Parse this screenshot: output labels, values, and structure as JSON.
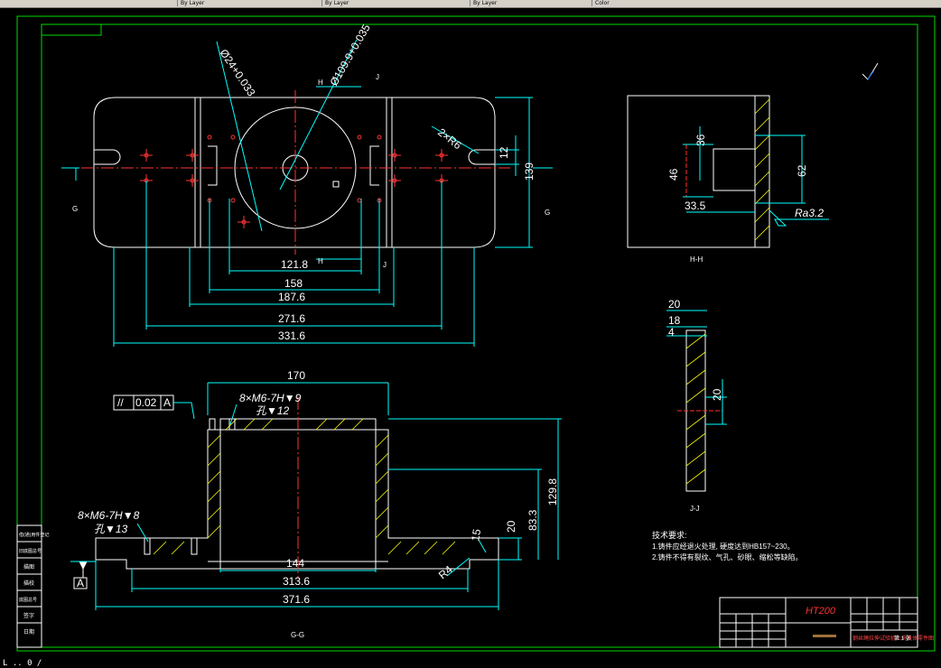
{
  "window": {
    "toolbar_segments": [
      "By Layer",
      "By Layer",
      "By Layer",
      "Color",
      "DKX"
    ],
    "command_line": "L .. 0 /"
  },
  "drawing": {
    "sectionMarks": {
      "h": "H",
      "j": "J",
      "g": "G"
    },
    "view_top": {
      "dia_hole": "Ø24+0.033",
      "dia_bore": "Ø109.9+0.035",
      "slot_radius": "2×R6",
      "height_12": "12",
      "height_139": "139",
      "dims": [
        "121.8",
        "158",
        "187.6",
        "271.6",
        "331.6"
      ]
    },
    "view_side": {
      "d36": "36",
      "d46": "46",
      "d62": "62",
      "d335": "33.5",
      "roughness": "Ra3.2",
      "label": "H-H"
    },
    "view_j": {
      "d20a": "20",
      "d18": "18",
      "d4": "4",
      "d20b": "20",
      "label": "J-J"
    },
    "view_front": {
      "width_top": "170",
      "parallel": "//",
      "tolerance": "0.02",
      "datum": "A",
      "thread_top": "8×M6-7H▼9",
      "hole_top": "孔▼12",
      "thread_left": "8×M6-7H▼8",
      "hole_left": "孔▼13",
      "d144": "144",
      "d3136": "313.6",
      "d3716": "371.6",
      "r4": "R4",
      "r15": "15",
      "d20": "20",
      "d833": "83.3",
      "d1298": "129.8",
      "label": "G-G",
      "datum_marker": "A"
    },
    "notes": {
      "heading": "技术要求:",
      "line1": "1.铸件应经退火处理, 硬度达到HB157~230。",
      "line2": "2.铸件不得有裂纹、气孔、砂眼、缩松等缺陷。"
    },
    "title_block": {
      "material": "HT200",
      "title": "钢丝绳拉伸试验机上夹具体零件图",
      "proj": "第 1 张"
    },
    "left_strip": [
      "借(通)用件登记",
      "旧底图总号",
      "描图",
      "描校",
      "底图总号",
      "签字",
      "日期"
    ],
    "colors": {
      "background": "#000000",
      "outline": "#ffffff",
      "dimension": "#00ffff",
      "centerline": "#ff3333",
      "hatch": "#ffff00",
      "border": "#00dd00"
    }
  }
}
